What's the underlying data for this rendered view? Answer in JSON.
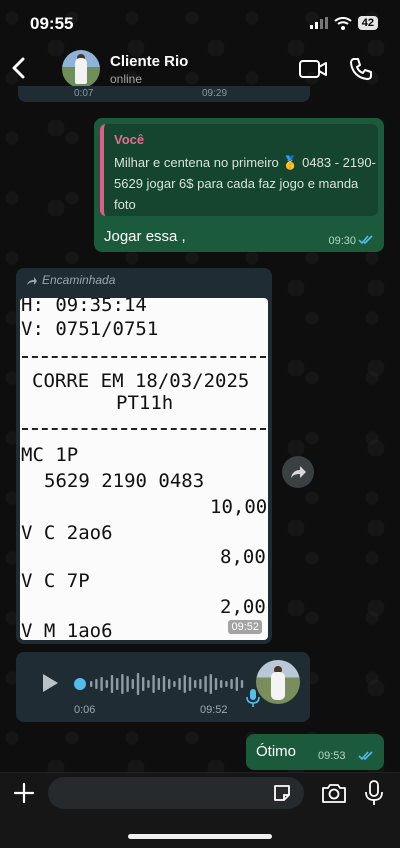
{
  "status_bar": {
    "time": "09:55",
    "battery": "42"
  },
  "header": {
    "back_icon": "chevron-left-icon",
    "contact_name": "Cliente Rio",
    "contact_status": "online",
    "video_icon": "video-camera-icon",
    "call_icon": "phone-icon"
  },
  "previous_message": {
    "start": "0:07",
    "time": "09:29"
  },
  "reply_message": {
    "quote_author": "Você",
    "quote_text": "Milhar e centena no primeiro 🥇 0483 - 2190- 5629 jogar 6$ para cada faz jogo e manda foto",
    "text": "Jogar essa ,",
    "time": "09:30",
    "status": "read"
  },
  "forwarded_image": {
    "label": "Encaminhada",
    "time": "09:52",
    "receipt_lines": [
      "H: 09:35:14",
      "V: 0751/0751",
      "CORRE EM 18/03/2025",
      "PT11h",
      "MC 1P",
      "5629 2190 0483",
      "10,00",
      "V C 2ao6",
      "8,00",
      "V C 7P",
      "2,00",
      "V M 1ao6"
    ]
  },
  "voice_message": {
    "position": "0:06",
    "time": "09:52"
  },
  "short_message": {
    "text": "Ótimo",
    "time": "09:53",
    "status": "read"
  },
  "input_bar": {
    "placeholder": ""
  },
  "colors": {
    "outgoing": "#1c5a3c",
    "incoming": "#1f2c33",
    "accent_blue": "#53bdeb",
    "quote_author": "#e86a95"
  }
}
